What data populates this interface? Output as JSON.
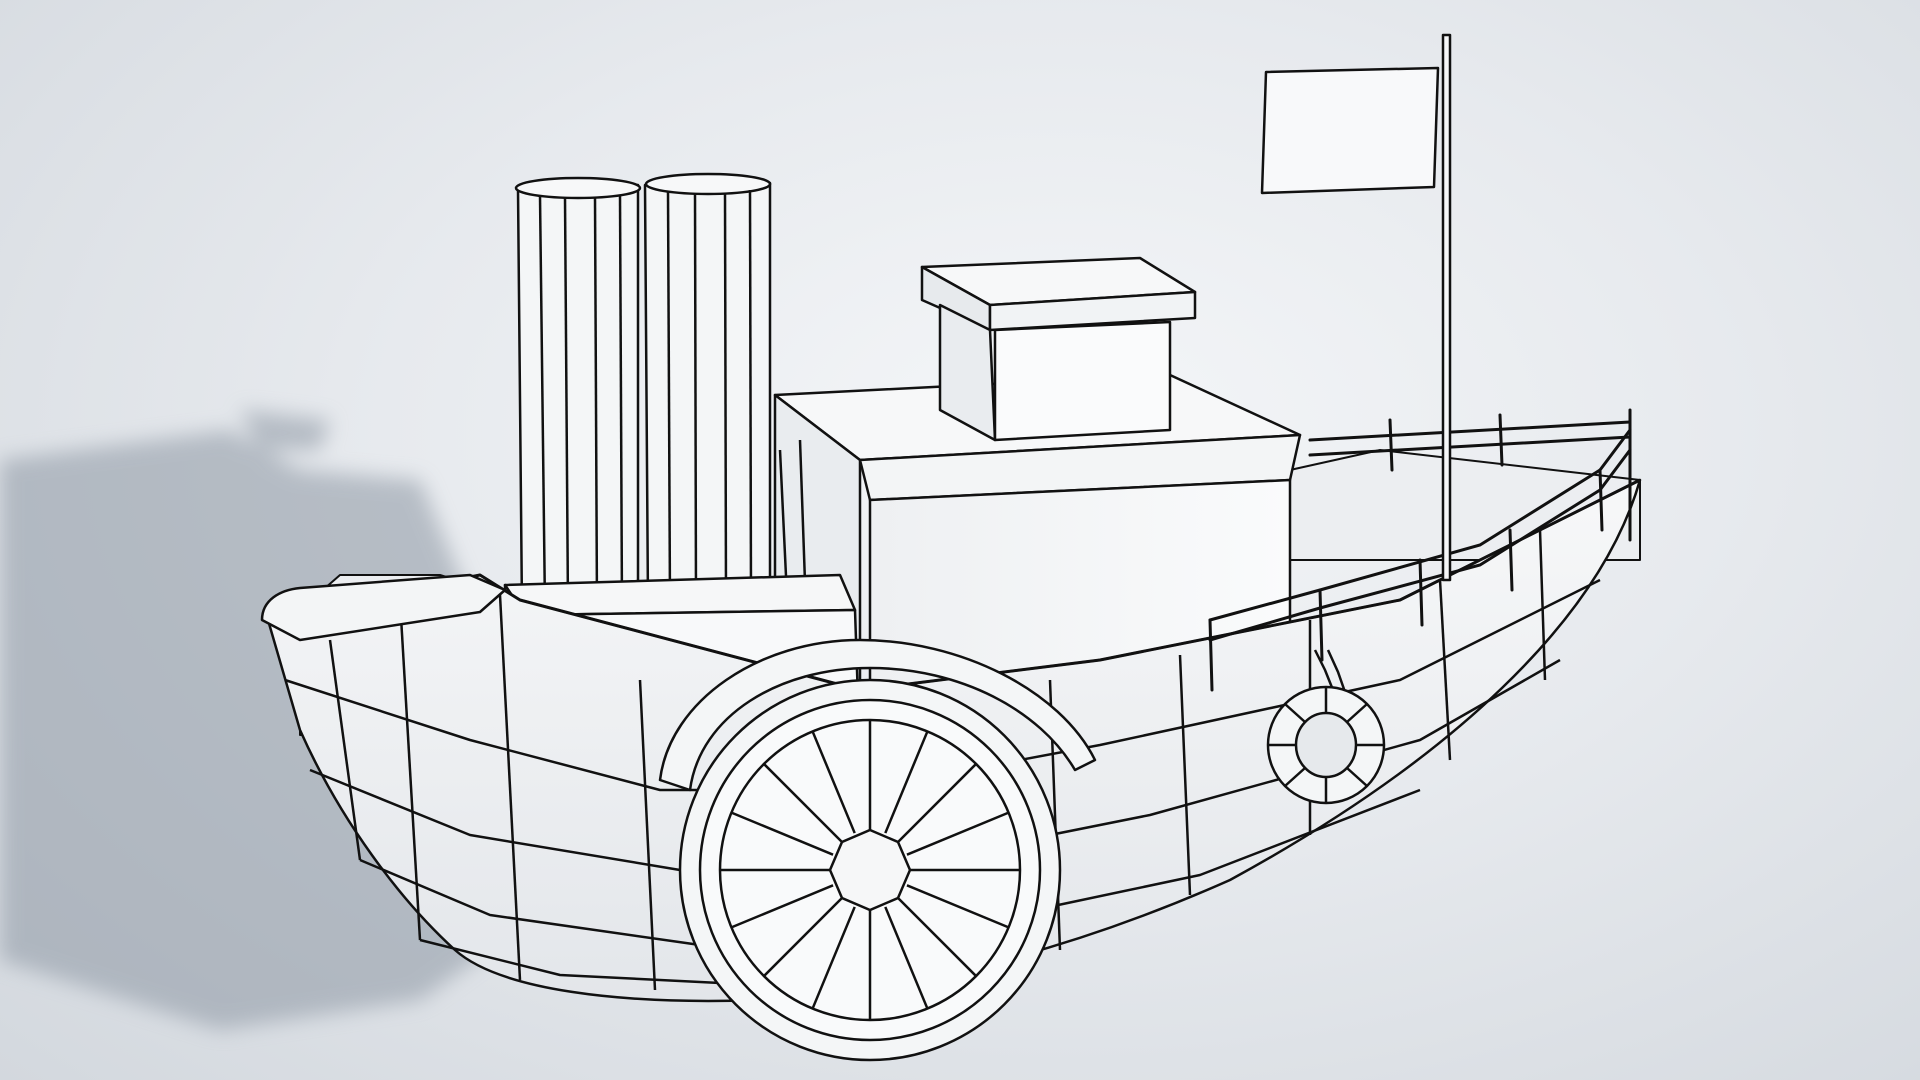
{
  "scene": {
    "subject": "paddle-steamer",
    "style": "wireframe-clay",
    "colors": {
      "background": "#e3e7eb",
      "model_fill": "#f6f7f8",
      "model_shade": "#e2e5e8",
      "wire": "#111111",
      "shadow": "#8e98a4"
    }
  }
}
